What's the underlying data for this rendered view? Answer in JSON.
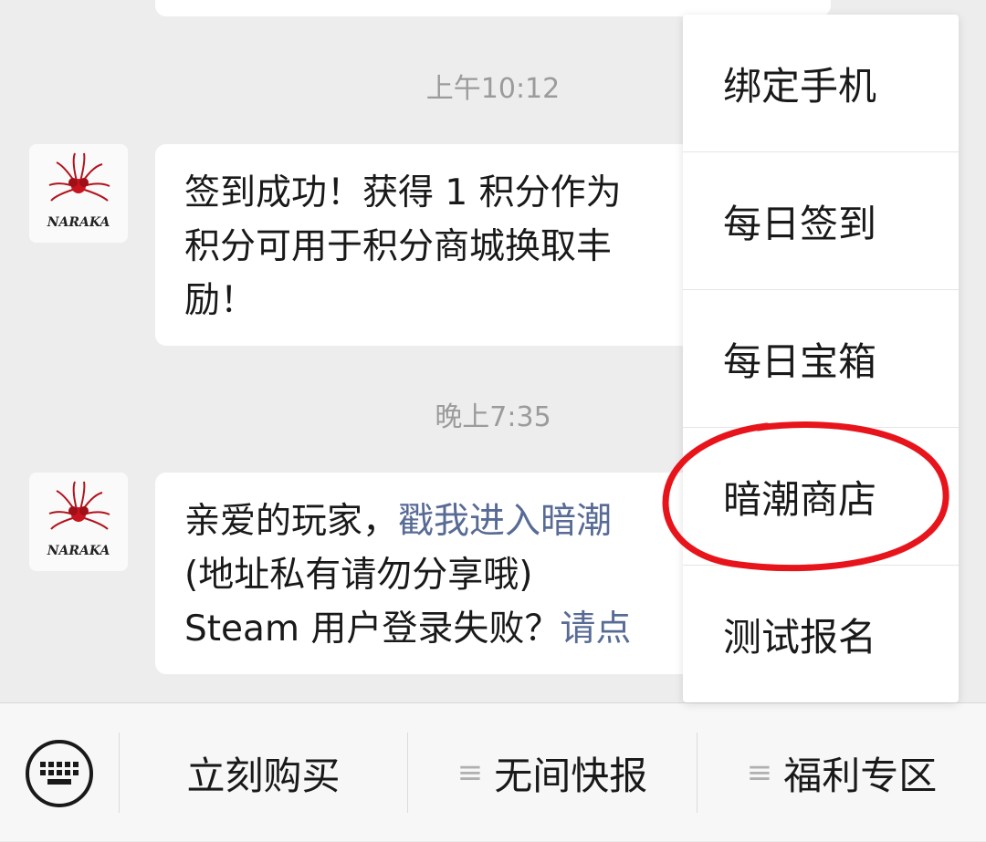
{
  "timestamps": [
    "上午10:12",
    "晚上7:35"
  ],
  "messages": [
    {
      "lines": [
        "签到成功！获得 1 积分作为",
        "积分可用于积分商城换取丰",
        "励！"
      ]
    },
    {
      "line1_text": "亲爱的玩家，",
      "line1_link": "戳我进入暗潮",
      "line2": "(地址私有请勿分享哦)",
      "line3_text": "Steam 用户登录失败？",
      "line3_link": "请点"
    }
  ],
  "avatar": {
    "brand_text": "NARAKA",
    "icon": "naraka-flower-logo"
  },
  "menu": {
    "items": [
      "绑定手机",
      "每日签到",
      "每日宝箱",
      "暗潮商店",
      "测试报名"
    ],
    "highlighted": "暗潮商店",
    "highlight_color": "#e8141b"
  },
  "bottom_bar": {
    "keyboard_icon": "keyboard-icon",
    "tabs": [
      {
        "label": "立刻购买",
        "has_submenu": false
      },
      {
        "label": "无间快报",
        "has_submenu": true
      },
      {
        "label": "福利专区",
        "has_submenu": true
      }
    ]
  },
  "colors": {
    "background": "#ededed",
    "link": "#576b95",
    "timestamp": "#9b9b9b"
  }
}
